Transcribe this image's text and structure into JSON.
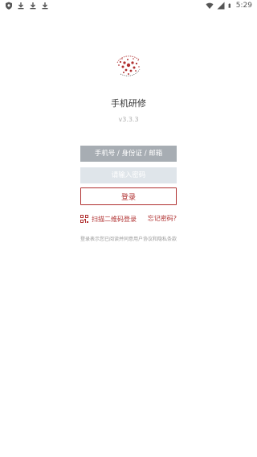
{
  "status_bar": {
    "icons_left": [
      "shield-icon",
      "download-icon",
      "download-icon",
      "download-icon"
    ],
    "icons_right": [
      "wifi-icon",
      "signal-icon",
      "battery-icon"
    ],
    "time": "5:29"
  },
  "app": {
    "title": "手机研修",
    "version": "v3.3.3",
    "brand_color": "#b03030"
  },
  "form": {
    "username_placeholder": "手机号 / 身份证 / 邮箱",
    "password_placeholder": "请输入密码",
    "login_label": "登录"
  },
  "links": {
    "qr_login": "扫描二维码登录",
    "forgot_password": "忘记密码?"
  },
  "terms_text": "登录表示您已阅读并同意用户协议和隐私条款"
}
